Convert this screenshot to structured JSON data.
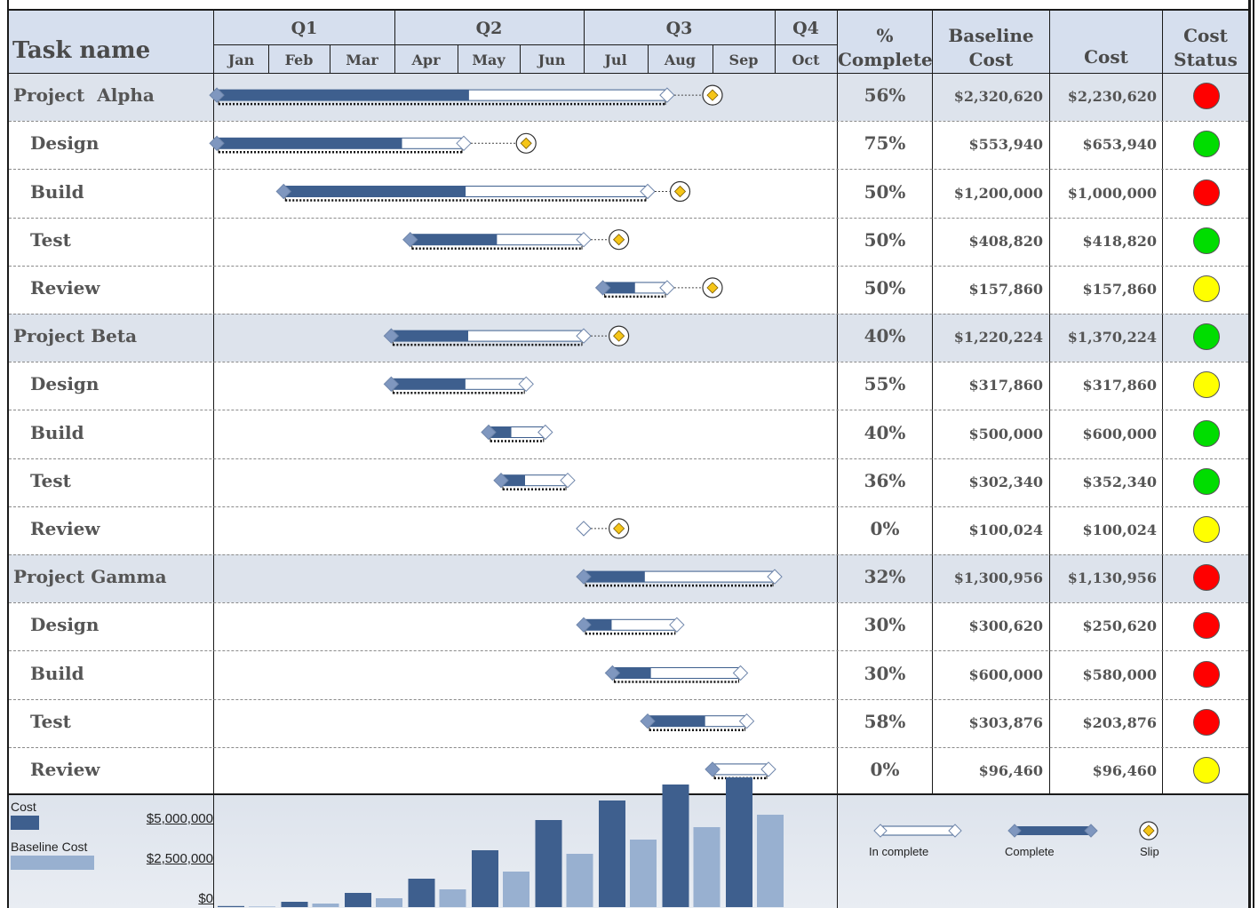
{
  "header": {
    "task_name": "Task name",
    "quarters": [
      "Q1",
      "Q2",
      "Q3",
      "Q4"
    ],
    "months": [
      "Jan",
      "Feb",
      "Mar",
      "Apr",
      "May",
      "Jun",
      "Jul",
      "Aug",
      "Sep",
      "Oct"
    ],
    "pct_line1": "%",
    "pct_line2": "Complete",
    "baseline_line1": "Baseline",
    "baseline_line2": "Cost",
    "cost": "Cost",
    "status_line1": "Cost",
    "status_line2": "Status"
  },
  "colors": {
    "header_bg": "#d6dfee",
    "project_row_bg": "#dde3ec",
    "complete_bar": "#3e5f8e",
    "baseline_bar": "#98b0d0",
    "slip_fill": "#f5c518",
    "status_red": "#ff0000",
    "status_green": "#00dd00",
    "status_yellow": "#ffff00"
  },
  "chart_data": {
    "type": "table",
    "tasks": [
      {
        "name": "Project  Alpha",
        "project": true,
        "start": 0.05,
        "end": 7.3,
        "progress": 0.56,
        "slip": 8.0,
        "pct": "56%",
        "baseline": "$2,320,620",
        "cost": "$2,230,620",
        "status": "red"
      },
      {
        "name": "Design",
        "project": false,
        "start": 0.05,
        "end": 4.1,
        "progress": 0.75,
        "slip": 5.1,
        "pct": "75%",
        "baseline": "$553,940",
        "cost": "$653,940",
        "status": "green"
      },
      {
        "name": "Build",
        "project": false,
        "start": 1.25,
        "end": 7.0,
        "progress": 0.5,
        "slip": 7.5,
        "pct": "50%",
        "baseline": "$1,200,000",
        "cost": "$1,000,000",
        "status": "red"
      },
      {
        "name": "Test",
        "project": false,
        "start": 3.25,
        "end": 6.0,
        "progress": 0.5,
        "slip": 6.55,
        "pct": "50%",
        "baseline": "$408,820",
        "cost": "$418,820",
        "status": "green"
      },
      {
        "name": "Review",
        "project": false,
        "start": 6.3,
        "end": 7.3,
        "progress": 0.5,
        "slip": 8.0,
        "pct": "50%",
        "baseline": "$157,860",
        "cost": "$157,860",
        "status": "yellow"
      },
      {
        "name": "Project Beta",
        "project": true,
        "start": 2.95,
        "end": 6.0,
        "progress": 0.4,
        "slip": 6.55,
        "pct": "40%",
        "baseline": "$1,220,224",
        "cost": "$1,370,224",
        "status": "green"
      },
      {
        "name": "Design",
        "project": false,
        "start": 2.95,
        "end": 5.1,
        "progress": 0.55,
        "slip": null,
        "pct": "55%",
        "baseline": "$317,860",
        "cost": "$317,860",
        "status": "yellow"
      },
      {
        "name": "Build",
        "project": false,
        "start": 4.5,
        "end": 5.4,
        "progress": 0.4,
        "slip": null,
        "pct": "40%",
        "baseline": "$500,000",
        "cost": "$600,000",
        "status": "green"
      },
      {
        "name": "Test",
        "project": false,
        "start": 4.7,
        "end": 5.75,
        "progress": 0.36,
        "slip": null,
        "pct": "36%",
        "baseline": "$302,340",
        "cost": "$352,340",
        "status": "green"
      },
      {
        "name": "Review",
        "project": false,
        "start": 6.0,
        "end": 6.0,
        "progress": 0,
        "slip": 6.55,
        "pct": "0%",
        "baseline": "$100,024",
        "cost": "$100,024",
        "status": "yellow"
      },
      {
        "name": "Project Gamma",
        "project": true,
        "start": 6.0,
        "end": 9.0,
        "progress": 0.32,
        "slip": null,
        "pct": "32%",
        "baseline": "$1,300,956",
        "cost": "$1,130,956",
        "status": "red"
      },
      {
        "name": "Design",
        "project": false,
        "start": 6.0,
        "end": 7.45,
        "progress": 0.3,
        "slip": null,
        "pct": "30%",
        "baseline": "$300,620",
        "cost": "$250,620",
        "status": "red"
      },
      {
        "name": "Build",
        "project": false,
        "start": 6.45,
        "end": 8.45,
        "progress": 0.3,
        "slip": null,
        "pct": "30%",
        "baseline": "$600,000",
        "cost": "$580,000",
        "status": "red"
      },
      {
        "name": "Test",
        "project": false,
        "start": 7.0,
        "end": 8.55,
        "progress": 0.58,
        "slip": null,
        "pct": "58%",
        "baseline": "$303,876",
        "cost": "$203,876",
        "status": "red"
      },
      {
        "name": "Review",
        "project": false,
        "start": 8.0,
        "end": 8.9,
        "progress": 0,
        "slip": null,
        "pct": "0%",
        "baseline": "$96,460",
        "cost": "$96,460",
        "status": "yellow"
      }
    ],
    "cost_chart": {
      "type": "bar",
      "series_names": [
        "Cost",
        "Baseline Cost"
      ],
      "y_ticks": [
        "$5,000,000",
        "$2,500,000",
        "$0"
      ],
      "ylim": [
        0,
        5000000
      ],
      "cost": [
        60000,
        300000,
        800000,
        1600000,
        3200000,
        4900000,
        6000000,
        6900000,
        7300000
      ],
      "baseline": [
        30000,
        200000,
        500000,
        1000000,
        2000000,
        3000000,
        3800000,
        4500000,
        5200000
      ]
    }
  },
  "legend": {
    "incomplete": "In complete",
    "complete": "Complete",
    "slip": "Slip"
  }
}
